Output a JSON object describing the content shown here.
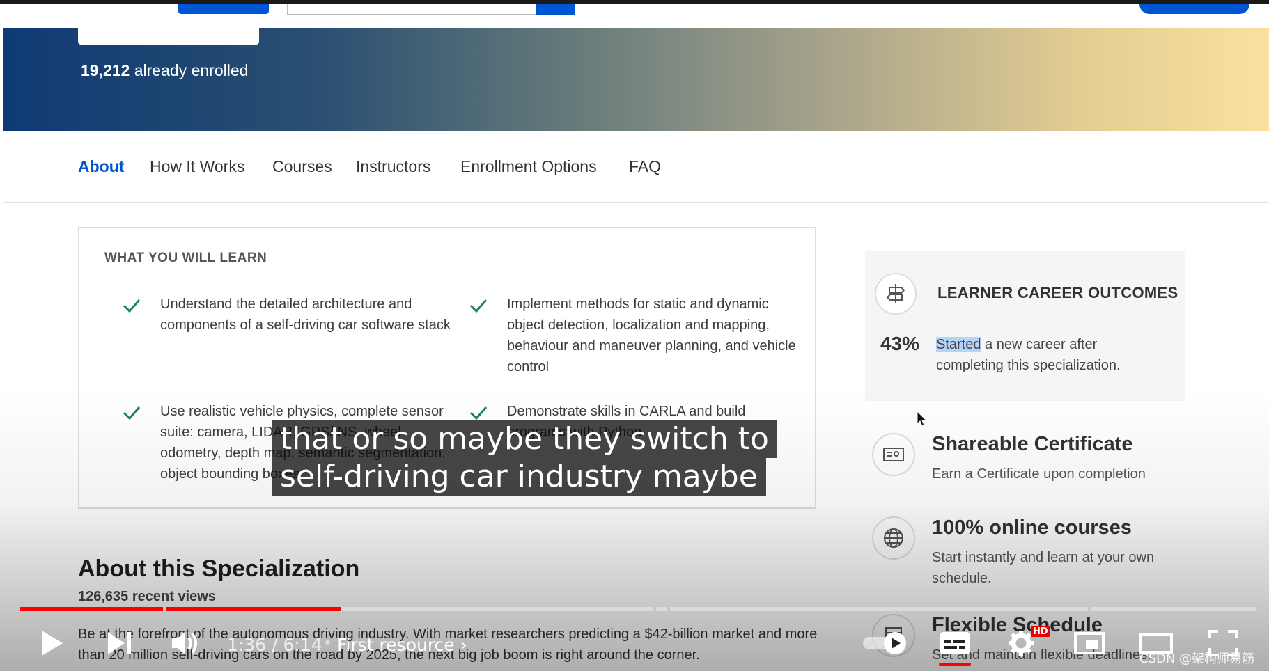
{
  "hero": {
    "enrolled_count": "19,212",
    "enrolled_suffix": " already enrolled"
  },
  "nav": {
    "tabs": [
      {
        "label": "About",
        "active": true
      },
      {
        "label": "How It Works"
      },
      {
        "label": "Courses"
      },
      {
        "label": "Instructors"
      },
      {
        "label": "Enrollment Options"
      },
      {
        "label": "FAQ"
      }
    ]
  },
  "learn": {
    "title": "WHAT YOU WILL LEARN",
    "items": [
      {
        "text": "Understand the detailed architecture and components of a self-driving car software stack"
      },
      {
        "text": "Implement methods for static and dynamic object detection, localization and mapping, behaviour and maneuver planning, and vehicle control"
      },
      {
        "text": "Use realistic vehicle physics, complete sensor suite: camera, LIDAR, GPS/INS, wheel odometry, depth map, semantic segmentation, object bounding boxes"
      },
      {
        "text": "Demonstrate skills in CARLA and build programs with Python"
      }
    ]
  },
  "outcomes": {
    "icon": "signpost-icon",
    "title": "LEARNER CAREER OUTCOMES",
    "percent": "43%",
    "highlight": "Started",
    "text_rest": " a new career after completing this specialization."
  },
  "features": [
    {
      "icon": "certificate-icon",
      "title": "Shareable Certificate",
      "subtitle": "Earn a Certificate upon completion"
    },
    {
      "icon": "globe-icon",
      "title": "100% online courses",
      "subtitle": "Start instantly and learn at your own schedule."
    },
    {
      "icon": "calendar-icon",
      "title": "Flexible Schedule",
      "subtitle": "Set and maintain flexible deadlines."
    }
  ],
  "about": {
    "title": "About this Specialization",
    "views": "126,635 recent views",
    "body": "Be at the forefront of the autonomous driving industry. With market researchers predicting a $42-billion market and more than 20 million self-driving cars on the road by 2025, the next big job boom is right around the corner."
  },
  "caption": {
    "line1": "that or so maybe they switch to",
    "line2": "self-driving car industry maybe"
  },
  "player": {
    "time": "1:36 / 6:14",
    "separator": "•",
    "chapter": "First resource",
    "hd_badge": "HD",
    "watermark": "CSDN @架构师易筋",
    "played_fraction": 0.26,
    "accent_color": "#ff0000"
  }
}
